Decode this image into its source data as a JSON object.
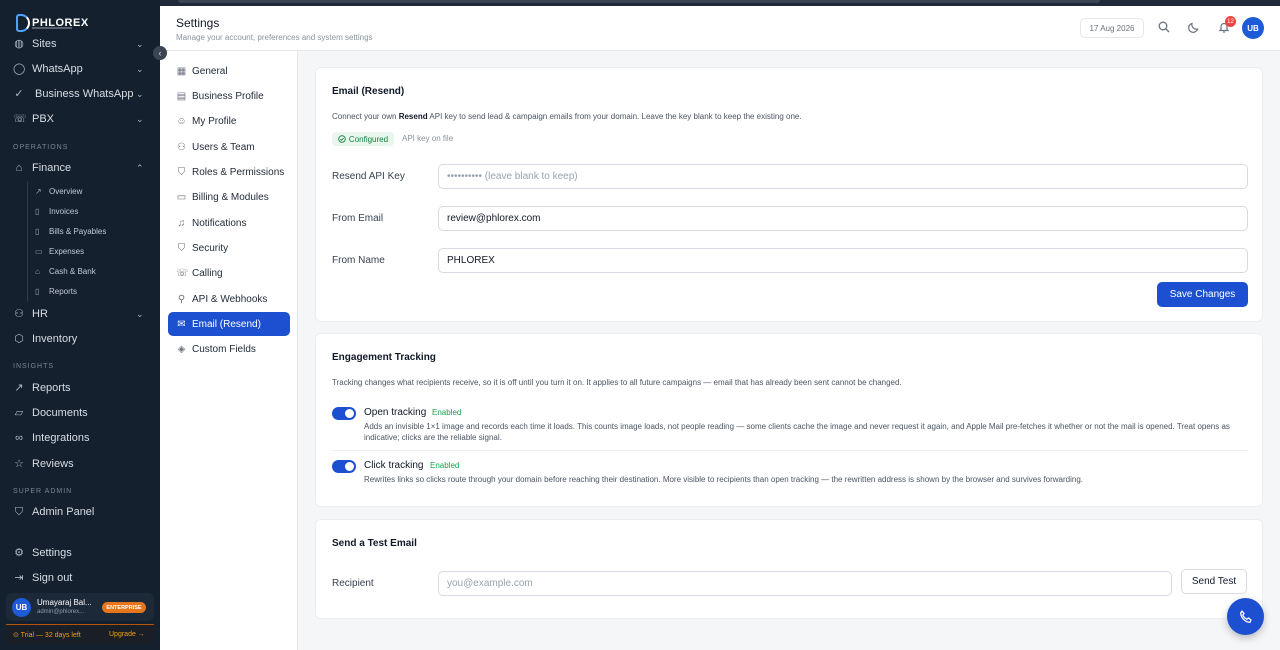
{
  "brand": {
    "logo_text": "PHLOREX"
  },
  "sidebar": {
    "items_top": [
      {
        "label": "Sites",
        "icon": "globe-icon"
      },
      {
        "label": "WhatsApp",
        "icon": "chat-icon"
      },
      {
        "label": "Business WhatsApp",
        "icon": "check-circle-icon"
      },
      {
        "label": "PBX",
        "icon": "phone-icon"
      }
    ],
    "section_operations": "OPERATIONS",
    "finance": {
      "label": "Finance",
      "subitems": [
        "Overview",
        "Invoices",
        "Bills & Payables",
        "Expenses",
        "Cash & Bank",
        "Reports"
      ]
    },
    "hr": "HR",
    "inventory": "Inventory",
    "section_insights": "INSIGHTS",
    "insights_items": [
      "Reports",
      "Documents",
      "Integrations",
      "Reviews"
    ],
    "section_super_admin": "SUPER ADMIN",
    "admin_panel": "Admin Panel",
    "settings": "Settings",
    "sign_out": "Sign out",
    "user": {
      "initials": "UB",
      "name": "Umayaraj Bal...",
      "email": "admin@phlorex...",
      "plan": "ENTERPRISE"
    },
    "trial": {
      "text": "⊙ Trial — 32 days left",
      "upgrade": "Upgrade →"
    }
  },
  "header": {
    "title": "Settings",
    "subtitle": "Manage your account, preferences and system settings",
    "date": "17 Aug 2026",
    "notification_count": "12",
    "avatar_initials": "UB"
  },
  "settings_nav": {
    "items": [
      {
        "label": "General",
        "icon": "building-icon"
      },
      {
        "label": "Business Profile",
        "icon": "briefcase-icon"
      },
      {
        "label": "My Profile",
        "icon": "user-icon"
      },
      {
        "label": "Users & Team",
        "icon": "users-icon"
      },
      {
        "label": "Roles & Permissions",
        "icon": "shield-icon"
      },
      {
        "label": "Billing & Modules",
        "icon": "credit-card-icon"
      },
      {
        "label": "Notifications",
        "icon": "bell-icon"
      },
      {
        "label": "Security",
        "icon": "lock-shield-icon"
      },
      {
        "label": "Calling",
        "icon": "phone-icon"
      },
      {
        "label": "API & Webhooks",
        "icon": "webhook-icon"
      },
      {
        "label": "Email (Resend)",
        "icon": "mail-icon"
      },
      {
        "label": "Custom Fields",
        "icon": "layers-icon"
      }
    ],
    "active_index": 10
  },
  "email_card": {
    "title": "Email (Resend)",
    "desc_pre": "Connect your own ",
    "desc_bold": "Resend",
    "desc_post": " API key to send lead & campaign emails from your domain. Leave the key blank to keep the existing one.",
    "status_badge": "Configured",
    "status_note": "API key on file",
    "api_key_label": "Resend API Key",
    "api_key_placeholder": "•••••••••• (leave blank to keep)",
    "from_email_label": "From Email",
    "from_email_value": "review@phlorex.com",
    "from_name_label": "From Name",
    "from_name_value": "PHLOREX",
    "save_label": "Save Changes"
  },
  "tracking_card": {
    "title": "Engagement Tracking",
    "desc": "Tracking changes what recipients receive, so it is off until you turn it on. It applies to all future campaigns — email that has already been sent cannot be changed.",
    "open": {
      "label": "Open tracking",
      "status": "Enabled",
      "enabled": true,
      "desc": "Adds an invisible 1×1 image and records each time it loads. This counts image loads, not people reading — some clients cache the image and never request it again, and Apple Mail pre-fetches it whether or not the mail is opened. Treat opens as indicative; clicks are the reliable signal."
    },
    "click": {
      "label": "Click tracking",
      "status": "Enabled",
      "enabled": true,
      "desc": "Rewrites links so clicks route through your domain before reaching their destination. More visible to recipients than open tracking — the rewritten address is shown by the browser and survives forwarding."
    }
  },
  "test_card": {
    "title": "Send a Test Email",
    "recipient_label": "Recipient",
    "recipient_placeholder": "you@example.com",
    "send_label": "Send Test"
  },
  "colors": {
    "accent": "#1d4fd1",
    "sidebar_bg": "#14202e",
    "success": "#16a34a",
    "badge_red": "#ef4444",
    "enterprise": "#e6761b"
  }
}
